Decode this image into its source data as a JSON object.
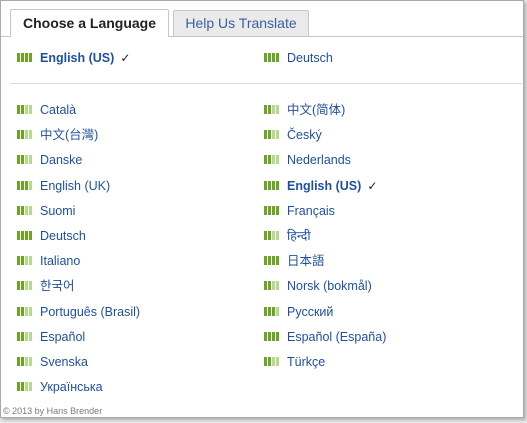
{
  "tabs": [
    {
      "label": "Choose a Language"
    },
    {
      "label": "Help Us Translate"
    }
  ],
  "top_languages": [
    {
      "label": "English (US)",
      "selected": true
    },
    {
      "label": "Deutsch",
      "selected": false
    }
  ],
  "selected_mark": "✓",
  "languages_left": [
    "Català",
    "中文(台灣)",
    "Danske",
    "English (UK)",
    "Suomi",
    "Deutsch",
    "Italiano",
    "한국어",
    "Português (Brasil)",
    "Español",
    "Svenska",
    "Українська"
  ],
  "languages_right": [
    "中文(简体)",
    "Český",
    "Nederlands",
    "English (US)",
    "Français",
    "हिन्दी",
    "日本語",
    "Norsk (bokmål)",
    "Русский",
    "Español (España)",
    "Türkçe"
  ],
  "copyright": "© 2013 by Hans Brender",
  "colors": {
    "link": "#1f4f9f",
    "bar": "#6aa622",
    "bar_light": "#b6d98e"
  }
}
